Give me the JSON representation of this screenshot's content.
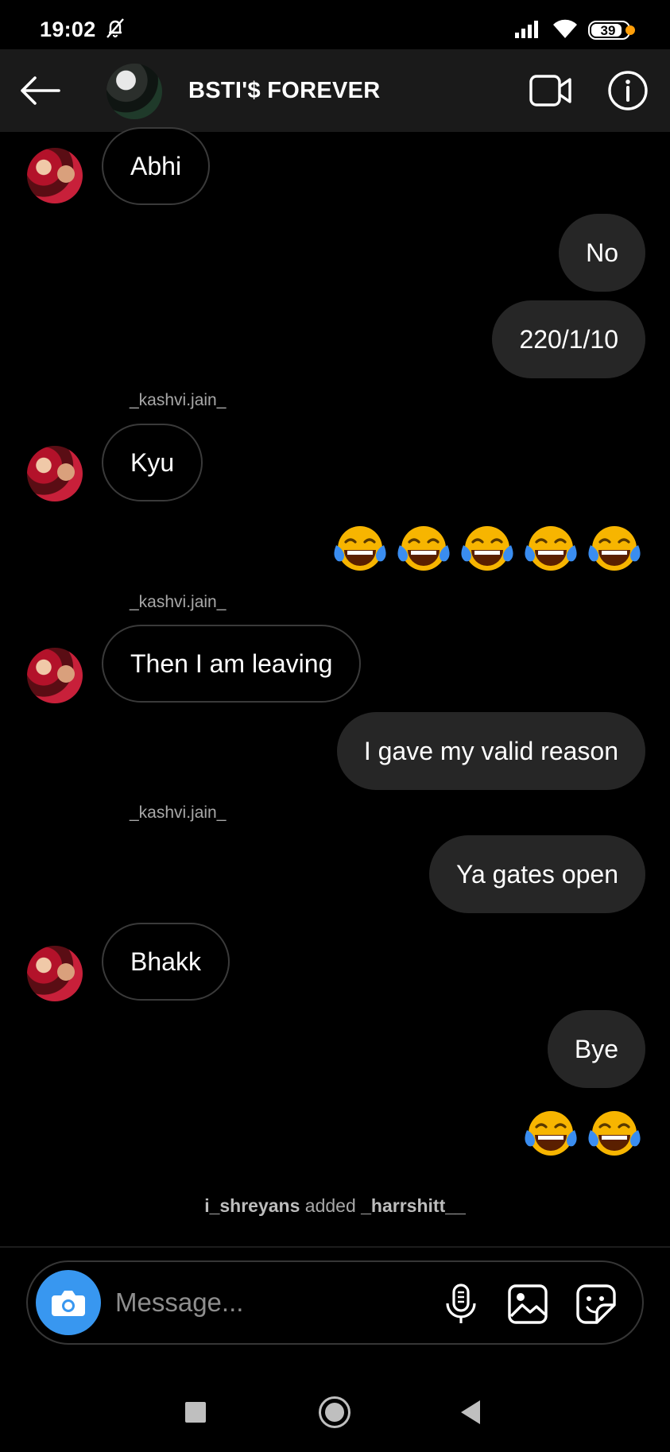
{
  "status_bar": {
    "time": "19:02",
    "battery": "39"
  },
  "header": {
    "title": "BSTI'$ FOREVER"
  },
  "messages": {
    "m1": "Abhi",
    "m2": "No",
    "m3": "220/1/10",
    "sender1": "_kashvi.jain_",
    "m4": "Kyu",
    "sender2": "_kashvi.jain_",
    "m5": "Then I am leaving",
    "m6": "I gave my valid reason",
    "sender3": "_kashvi.jain_",
    "m7": "Ya gates open",
    "m8": "Bhakk",
    "m9": "Bye"
  },
  "emoji_rows": {
    "row1_count": 5,
    "row2_count": 2,
    "emoji": "face-with-tears-of-joy"
  },
  "system_note": {
    "actor": "i_shreyans",
    "action": " added ",
    "target": "_harrshitt__"
  },
  "composer": {
    "placeholder": "Message..."
  },
  "colors": {
    "accent": "#3897f0",
    "outgoing_bubble": "#262626",
    "header_bg": "#1a1a1a",
    "emoji_face": "#f7b500",
    "tears": "#3a8df0"
  }
}
